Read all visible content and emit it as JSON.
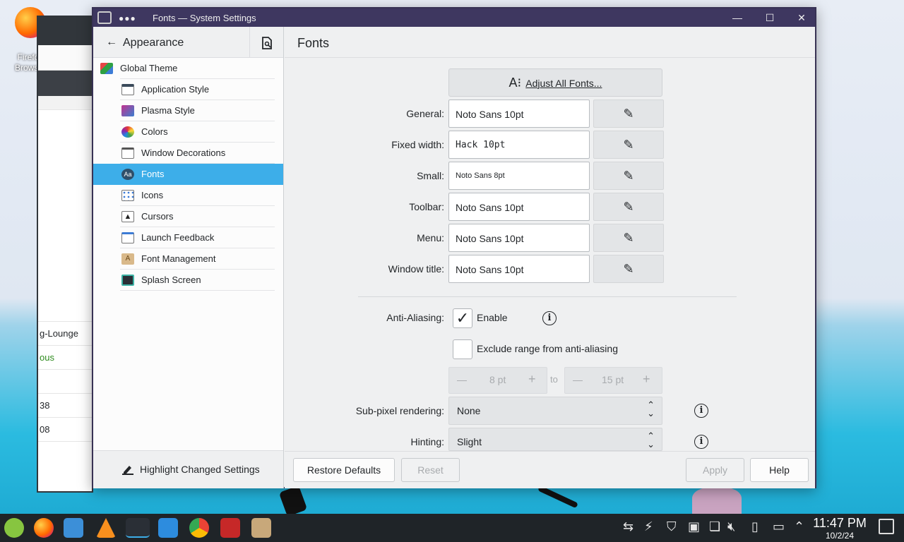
{
  "desktop": {
    "icons": [
      {
        "label": "Firefox Browser",
        "icon": "firefox-icon"
      }
    ],
    "background_window": {
      "rows": [
        "g-Lounge",
        "ous",
        "38",
        "08"
      ]
    }
  },
  "window": {
    "title": "Fonts — System Settings",
    "dots": "●●●",
    "controls": {
      "minimize": "—",
      "maximize": "☐",
      "close": "✕"
    }
  },
  "sidebar": {
    "back_label": "Appearance",
    "items": [
      {
        "label": "Global Theme",
        "icon": "global-theme-icon",
        "level": 0,
        "active": false
      },
      {
        "label": "Application Style",
        "icon": "application-style-icon",
        "level": 1,
        "active": false
      },
      {
        "label": "Plasma Style",
        "icon": "plasma-style-icon",
        "level": 1,
        "active": false
      },
      {
        "label": "Colors",
        "icon": "colors-icon",
        "level": 1,
        "active": false
      },
      {
        "label": "Window Decorations",
        "icon": "window-decorations-icon",
        "level": 1,
        "active": false
      },
      {
        "label": "Fonts",
        "icon": "fonts-icon",
        "level": 1,
        "active": true
      },
      {
        "label": "Icons",
        "icon": "icons-icon",
        "level": 1,
        "active": false
      },
      {
        "label": "Cursors",
        "icon": "cursors-icon",
        "level": 1,
        "active": false
      },
      {
        "label": "Launch Feedback",
        "icon": "launch-feedback-icon",
        "level": 1,
        "active": false
      },
      {
        "label": "Font Management",
        "icon": "font-management-icon",
        "level": 1,
        "active": false
      },
      {
        "label": "Splash Screen",
        "icon": "splash-screen-icon",
        "level": 1,
        "active": false
      }
    ],
    "footer_label": "Highlight Changed Settings"
  },
  "main": {
    "title": "Fonts",
    "adjust_all_label": "Adjust All Fonts...",
    "font_rows": [
      {
        "label": "General:",
        "value": "Noto Sans 10pt"
      },
      {
        "label": "Fixed width:",
        "value": "Hack 10pt"
      },
      {
        "label": "Small:",
        "value": "Noto Sans 8pt"
      },
      {
        "label": "Toolbar:",
        "value": "Noto Sans 10pt"
      },
      {
        "label": "Menu:",
        "value": "Noto Sans 10pt"
      },
      {
        "label": "Window title:",
        "value": "Noto Sans 10pt"
      }
    ],
    "anti_aliasing": {
      "label": "Anti-Aliasing:",
      "enable_label": "Enable",
      "enable_checked": true,
      "exclude_label": "Exclude range from anti-aliasing",
      "exclude_checked": false,
      "range_from": "8 pt",
      "range_to_label": "to",
      "range_to": "15 pt"
    },
    "subpixel": {
      "label": "Sub-pixel rendering:",
      "value": "None"
    },
    "hinting": {
      "label": "Hinting:",
      "value": "Slight"
    },
    "footer": {
      "restore_defaults": "Restore Defaults",
      "reset": "Reset",
      "apply": "Apply",
      "help": "Help"
    }
  },
  "taskbar": {
    "apps": [
      "mint-menu-icon",
      "firefox-icon",
      "files-icon",
      "vlc-icon",
      "system-settings-icon",
      "software-store-icon",
      "chrome-icon",
      "terminal-app-icon",
      "archive-icon"
    ],
    "clock_time": "11:47 PM",
    "clock_date": "10/2/24"
  },
  "colors": {
    "accent": "#3daee9",
    "titlebar": "#3e3760",
    "taskbar": "#1f2428"
  }
}
